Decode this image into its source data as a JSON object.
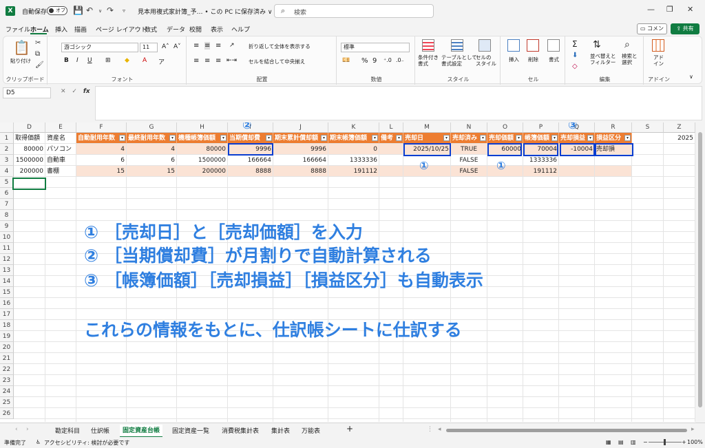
{
  "titlebar": {
    "autosave_label": "自動保存",
    "autosave_state": "オフ",
    "doc_title": "見本用複式家計簿_予… • この PC に保存済み ∨",
    "search_placeholder": "検索"
  },
  "menu": {
    "tabs": [
      "ファイル",
      "ホーム",
      "挿入",
      "描画",
      "ページ レイアウト",
      "数式",
      "データ",
      "校閲",
      "表示",
      "ヘルプ"
    ],
    "active": "ホーム",
    "comment_label": "コメント",
    "share_label": "共有"
  },
  "ribbon": {
    "clipboard": {
      "paste": "貼り付け",
      "label": "クリップボード"
    },
    "font": {
      "name": "游ゴシック",
      "size": "11",
      "label": "フォント"
    },
    "alignment": {
      "wrap": "折り返して全体を表示する",
      "merge": "セルを結合して中央揃え",
      "label": "配置"
    },
    "number": {
      "format": "標準",
      "label": "数値"
    },
    "styles": {
      "conditional": "条件付き\n書式",
      "table": "テーブルとして\n書式設定",
      "cellstyle": "セルの\nスタイル",
      "label": "スタイル"
    },
    "cells": {
      "insert": "挿入",
      "delete": "削除",
      "format": "書式",
      "label": "セル"
    },
    "editing": {
      "sort": "並べ替えと\nフィルター",
      "find": "検索と\n選択",
      "label": "編集"
    },
    "addins": {
      "addin": "アド\nイン",
      "label": "アドイン"
    }
  },
  "formula_bar": {
    "namebox": "D5",
    "fx": "fx",
    "value": ""
  },
  "columns": [
    {
      "letter": "D",
      "header": "取得価額"
    },
    {
      "letter": "E",
      "header": "資産名"
    },
    {
      "letter": "F",
      "header": "自動耐用年数"
    },
    {
      "letter": "G",
      "header": "最終耐用年数"
    },
    {
      "letter": "H",
      "header": "機種帳簿価額"
    },
    {
      "letter": "I",
      "header": "当期償却費"
    },
    {
      "letter": "J",
      "header": "期末累計償却額"
    },
    {
      "letter": "K",
      "header": "期末帳簿価額"
    },
    {
      "letter": "L",
      "header": "備考"
    },
    {
      "letter": "M",
      "header": "売却日"
    },
    {
      "letter": "N",
      "header": "売却済み"
    },
    {
      "letter": "O",
      "header": "売却価額"
    },
    {
      "letter": "P",
      "header": "帳簿価額"
    },
    {
      "letter": "Q",
      "header": "売却損益"
    },
    {
      "letter": "R",
      "header": "損益区分"
    },
    {
      "letter": "S",
      "header": ""
    },
    {
      "letter": "Z",
      "header": ""
    }
  ],
  "rows": [
    [
      "80000",
      "パソコン",
      "4",
      "4",
      "80000",
      "9996",
      "9996",
      "0",
      "",
      "2025/10/25",
      "TRUE",
      "60000",
      "70004",
      "-10004",
      "売却損"
    ],
    [
      "1500000",
      "自動車",
      "6",
      "6",
      "1500000",
      "166664",
      "166664",
      "1333336",
      "",
      "",
      "FALSE",
      "",
      "1333336",
      "",
      ""
    ],
    [
      "200000",
      "書棚",
      "15",
      "15",
      "200000",
      "8888",
      "8888",
      "191112",
      "",
      "",
      "FALSE",
      "",
      "191112",
      "",
      ""
    ]
  ],
  "z1_value": "2025",
  "row_numbers": [
    "1",
    "2",
    "3",
    "4",
    "5",
    "6",
    "7",
    "8",
    "9",
    "10",
    "11",
    "12",
    "13",
    "14",
    "15",
    "16",
    "17",
    "18",
    "19",
    "20",
    "21",
    "22",
    "23",
    "24",
    "25",
    "26"
  ],
  "markers": {
    "one": "①",
    "two": "②",
    "three": "③"
  },
  "annotations": [
    "① ［売却日］と［売却価額］を入力",
    "② ［当期償却費］が月割りで自動計算される",
    "③ ［帳簿価額］［売却損益］［損益区分］も自動表示",
    "これらの情報をもとに、仕訳帳シートに仕訳する"
  ],
  "sheets": [
    "勘定科目",
    "仕訳帳",
    "固定資産台帳",
    "固定資産一覧",
    "消費税集計表",
    "集計表",
    "万能表"
  ],
  "active_sheet": "固定資産台帳",
  "status": {
    "ready": "準備完了",
    "accessibility": "アクセシビリティ: 検討が必要です",
    "zoom": "100%"
  },
  "colors": {
    "accent": "#107c41",
    "table_header": "#ed7d31",
    "band": "#fbe3d5",
    "annotation": "#2f7fe0",
    "highlight": "#0a3dd0"
  }
}
